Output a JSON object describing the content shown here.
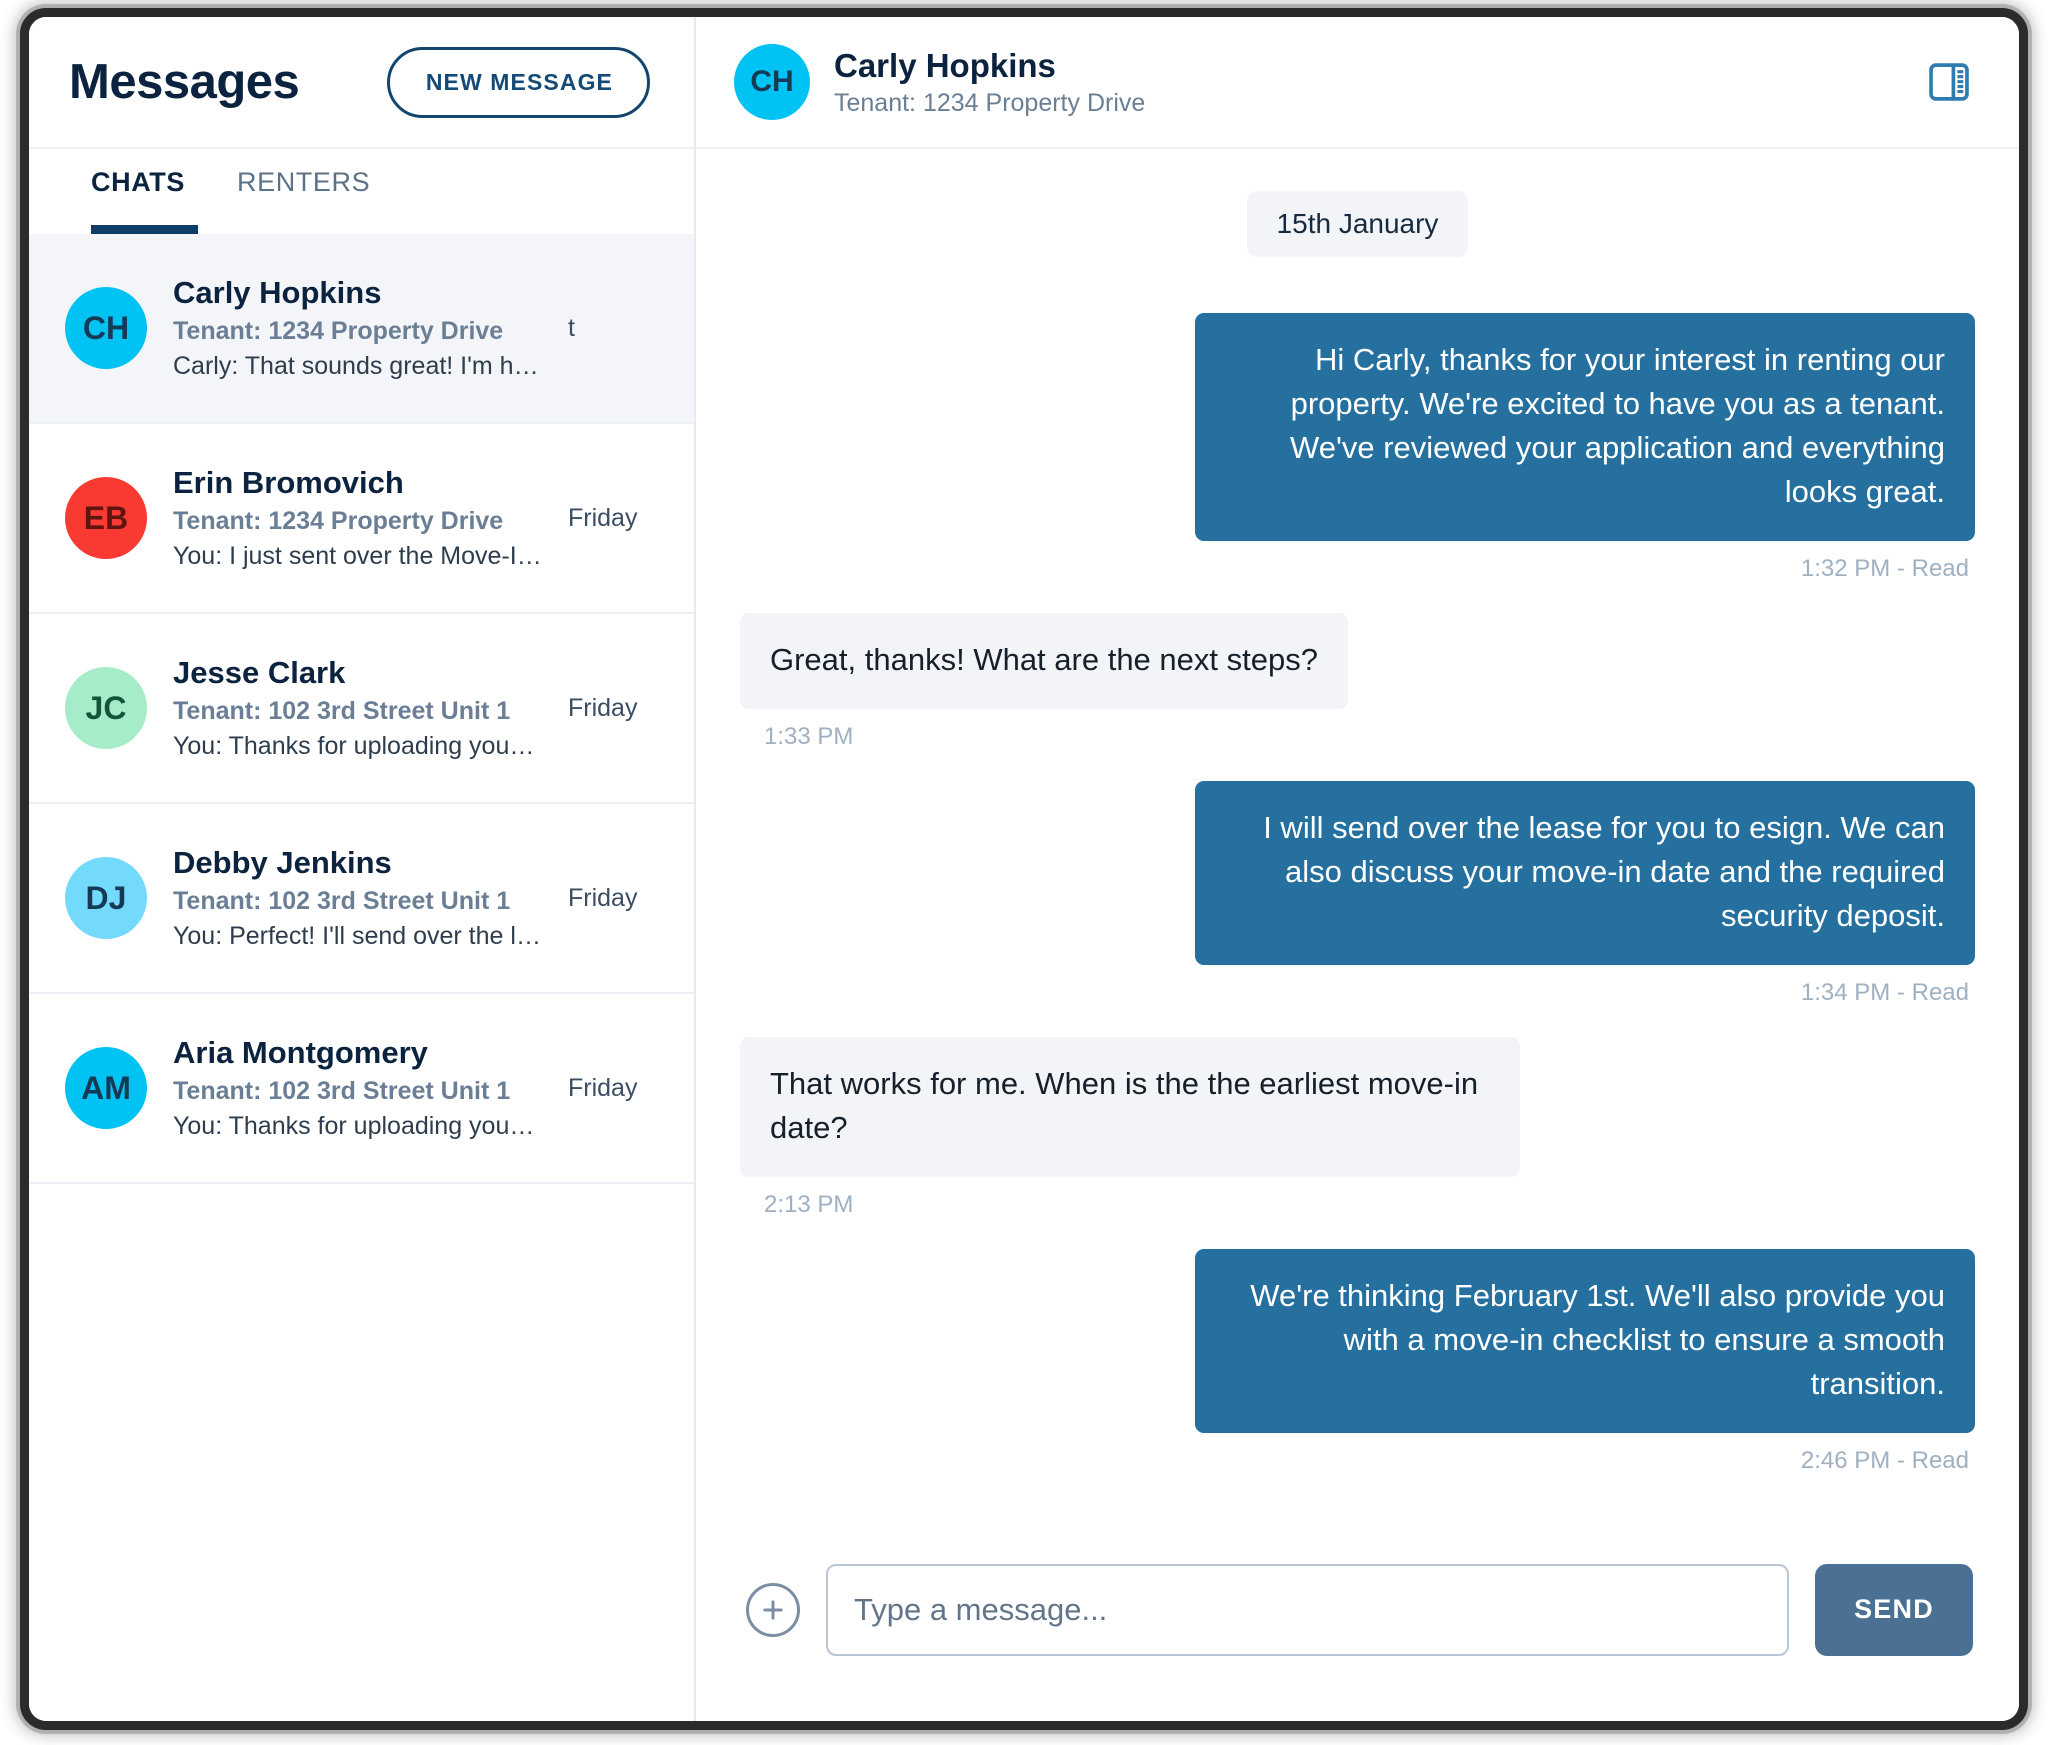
{
  "colors": {
    "brand_dark": "#0c2340",
    "accent_blue": "#25709f",
    "send_button": "#4a7094",
    "tab_underline": "#0d3d68",
    "outgoing_bubble": "#25709f",
    "incoming_bubble": "#f2f4f7"
  },
  "left": {
    "title": "Messages",
    "new_message_label": "NEW MESSAGE",
    "tabs": [
      {
        "label": "CHATS",
        "active": true
      },
      {
        "label": "RENTERS",
        "active": false
      }
    ],
    "chats": [
      {
        "initials": "CH",
        "avatar_color": "#00c2f3",
        "avatar_text_class": "",
        "name": "Carly Hopkins",
        "subtitle": "Tenant: 1234 Property Drive",
        "preview": "Carly: That sounds great! I'm hap...",
        "time": "t",
        "selected": true
      },
      {
        "initials": "EB",
        "avatar_color": "#f83a32",
        "avatar_text_class": "red",
        "name": "Erin Bromovich",
        "subtitle": "Tenant: 1234 Property Drive",
        "preview": "You: I just sent over the Move-In...",
        "time": "Friday",
        "selected": false
      },
      {
        "initials": "JC",
        "avatar_color": "#a6ecc8",
        "avatar_text_class": "green",
        "name": "Jesse Clark",
        "subtitle": "Tenant: 102 3rd Street Unit 1",
        "preview": "You: Thanks for uploading your d...",
        "time": "Friday",
        "selected": false
      },
      {
        "initials": "DJ",
        "avatar_color": "#74dafb",
        "avatar_text_class": "",
        "name": "Debby Jenkins",
        "subtitle": "Tenant: 102 3rd Street Unit 1",
        "preview": "You: Perfect! I'll send over the lea...",
        "time": "Friday",
        "selected": false
      },
      {
        "initials": "AM",
        "avatar_color": "#00c2f3",
        "avatar_text_class": "",
        "name": "Aria Montgomery",
        "subtitle": "Tenant: 102 3rd Street Unit 1",
        "preview": "You: Thanks for uploading your d...",
        "time": "Friday",
        "selected": false
      }
    ]
  },
  "conversation": {
    "avatar_initials": "CH",
    "avatar_color": "#00c2f3",
    "name": "Carly Hopkins",
    "subtitle": "Tenant: 1234 Property Drive",
    "panel_toggle_icon": "side-panel-icon",
    "date_divider": "15th January",
    "messages": [
      {
        "direction": "out",
        "text": "Hi Carly, thanks for your interest in renting our property. We're excited to have you as a tenant. We've reviewed your application and everything looks great.",
        "meta": "1:32 PM - Read"
      },
      {
        "direction": "in",
        "text": "Great, thanks! What are the next steps?",
        "meta": "1:33 PM"
      },
      {
        "direction": "out",
        "text": "I will send over the lease for you to esign. We can also discuss your move-in date and the required security deposit.",
        "meta": "1:34 PM - Read"
      },
      {
        "direction": "in",
        "text": "That works for me. When is the the earliest move-in date?",
        "meta": "2:13 PM"
      },
      {
        "direction": "out",
        "text": "We're thinking February 1st. We'll also provide you with a move-in checklist to ensure a smooth transition.",
        "meta": "2:46 PM - Read"
      }
    ]
  },
  "composer": {
    "attach_icon": "plus-circle-icon",
    "placeholder": "Type a message...",
    "value": "",
    "send_label": "SEND"
  }
}
